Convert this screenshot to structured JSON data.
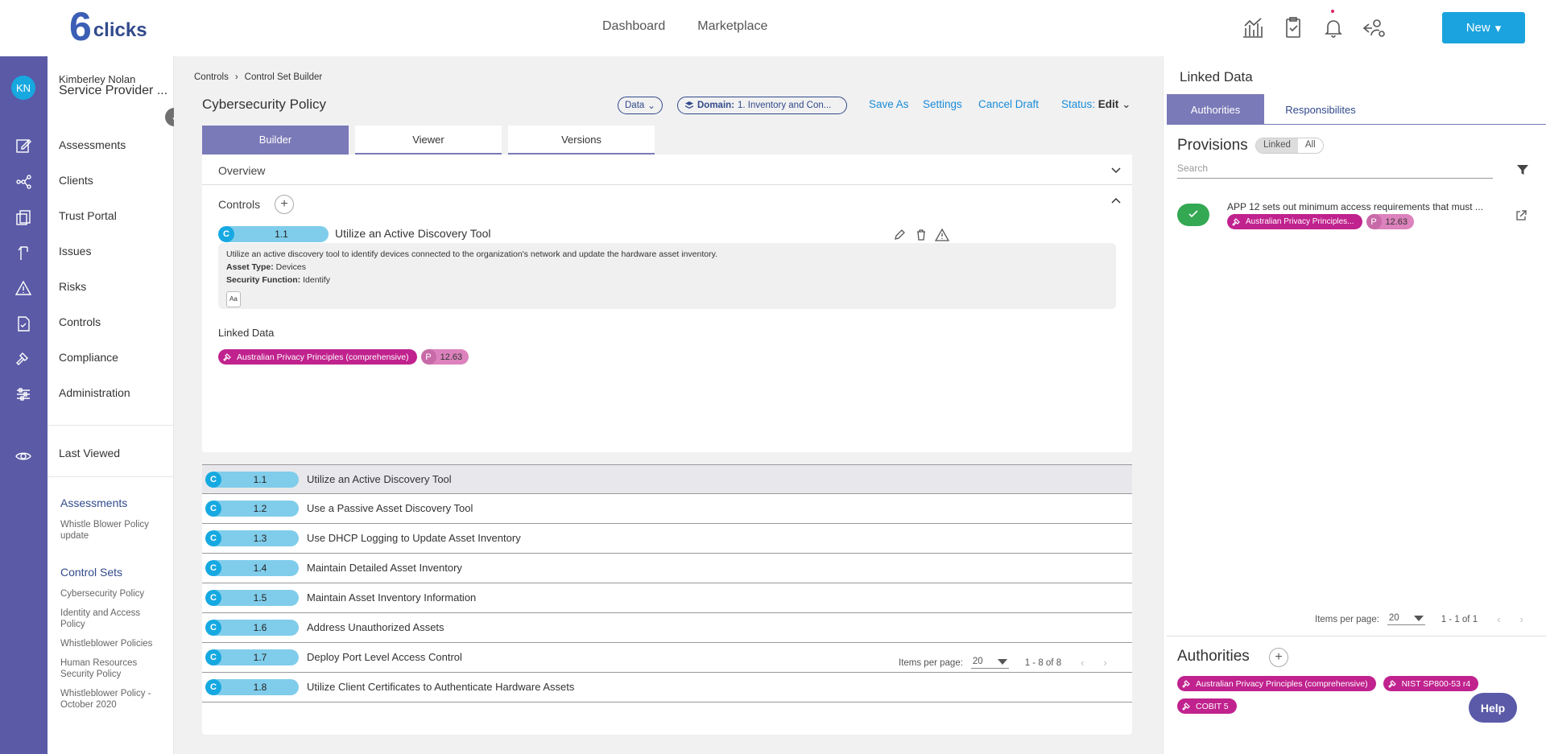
{
  "brand": {
    "mark": "6",
    "word": "clicks"
  },
  "topnav": [
    "Dashboard",
    "Marketplace"
  ],
  "new_button": "New",
  "user": {
    "initials": "KN",
    "name": "Kimberley Nolan",
    "org": "Service Provider ..."
  },
  "sidebar": {
    "items": [
      "Assessments",
      "Clients",
      "Trust Portal",
      "Issues",
      "Risks",
      "Controls",
      "Compliance",
      "Administration"
    ],
    "last_viewed": "Last Viewed",
    "recent": {
      "assessments_title": "Assessments",
      "assessments": [
        "Whistle Blower Policy update"
      ],
      "control_sets_title": "Control Sets",
      "control_sets": [
        "Cybersecurity Policy",
        "Identity and Access Policy",
        "Whistleblower Policies",
        "Human Resources Security Policy",
        "Whistleblower Policy - October 2020"
      ]
    }
  },
  "breadcrumb": [
    "Controls",
    "Control Set Builder"
  ],
  "page_title": "Cybersecurity Policy",
  "data_pill": "Data",
  "domain_pill": {
    "label": "Domain:",
    "value": "1. Inventory and Con..."
  },
  "actions": {
    "save_as": "Save As",
    "settings": "Settings",
    "cancel_draft": "Cancel Draft",
    "status_label": "Status:",
    "status_value": "Edit"
  },
  "tabs": [
    "Builder",
    "Viewer",
    "Versions"
  ],
  "overview_label": "Overview",
  "controls_label": "Controls",
  "selected_control": {
    "badge": "C",
    "number": "1.1",
    "title": "Utilize an Active Discovery Tool",
    "description": "Utilize an active discovery tool to identify devices connected to the organization's network and update the hardware asset inventory.",
    "asset_type_label": "Asset Type:",
    "asset_type": "Devices",
    "security_function_label": "Security Function:",
    "security_function": "Identify",
    "aa": "Aa",
    "linked_data_label": "Linked Data",
    "linked_tag": "Australian Privacy Principles (comprehensive)",
    "p_badge": "P",
    "p_value": "12.63"
  },
  "control_list": [
    {
      "badge": "C",
      "number": "1.1",
      "title": "Utilize an Active Discovery Tool"
    },
    {
      "badge": "C",
      "number": "1.2",
      "title": "Use a Passive Asset Discovery Tool"
    },
    {
      "badge": "C",
      "number": "1.3",
      "title": "Use DHCP Logging to Update Asset Inventory"
    },
    {
      "badge": "C",
      "number": "1.4",
      "title": "Maintain Detailed Asset Inventory"
    },
    {
      "badge": "C",
      "number": "1.5",
      "title": "Maintain Asset Inventory Information"
    },
    {
      "badge": "C",
      "number": "1.6",
      "title": "Address Unauthorized Assets"
    },
    {
      "badge": "C",
      "number": "1.7",
      "title": "Deploy Port Level Access Control"
    },
    {
      "badge": "C",
      "number": "1.8",
      "title": "Utilize Client Certificates to Authenticate Hardware Assets"
    }
  ],
  "pager": {
    "items_label": "Items per page:",
    "per_page": "20",
    "range": "1 - 8 of 8"
  },
  "right_panel": {
    "title": "Linked Data",
    "tabs": [
      "Authorities",
      "Responsibilites"
    ],
    "provisions_title": "Provisions",
    "toggle": [
      "Linked",
      "All"
    ],
    "search_placeholder": "Search",
    "provision": {
      "text": "APP 12 sets out minimum access requirements that must ...",
      "tag": "Australian Privacy Principles...",
      "p_badge": "P",
      "p_value": "12.63"
    },
    "pager": {
      "items_label": "Items per page:",
      "per_page": "20",
      "range": "1 - 1 of 1"
    },
    "authorities_title": "Authorities",
    "authorities": [
      "Australian Privacy Principles (comprehensive)",
      "NIST SP800-53 r4",
      "COBIT 5"
    ]
  },
  "help": "Help"
}
